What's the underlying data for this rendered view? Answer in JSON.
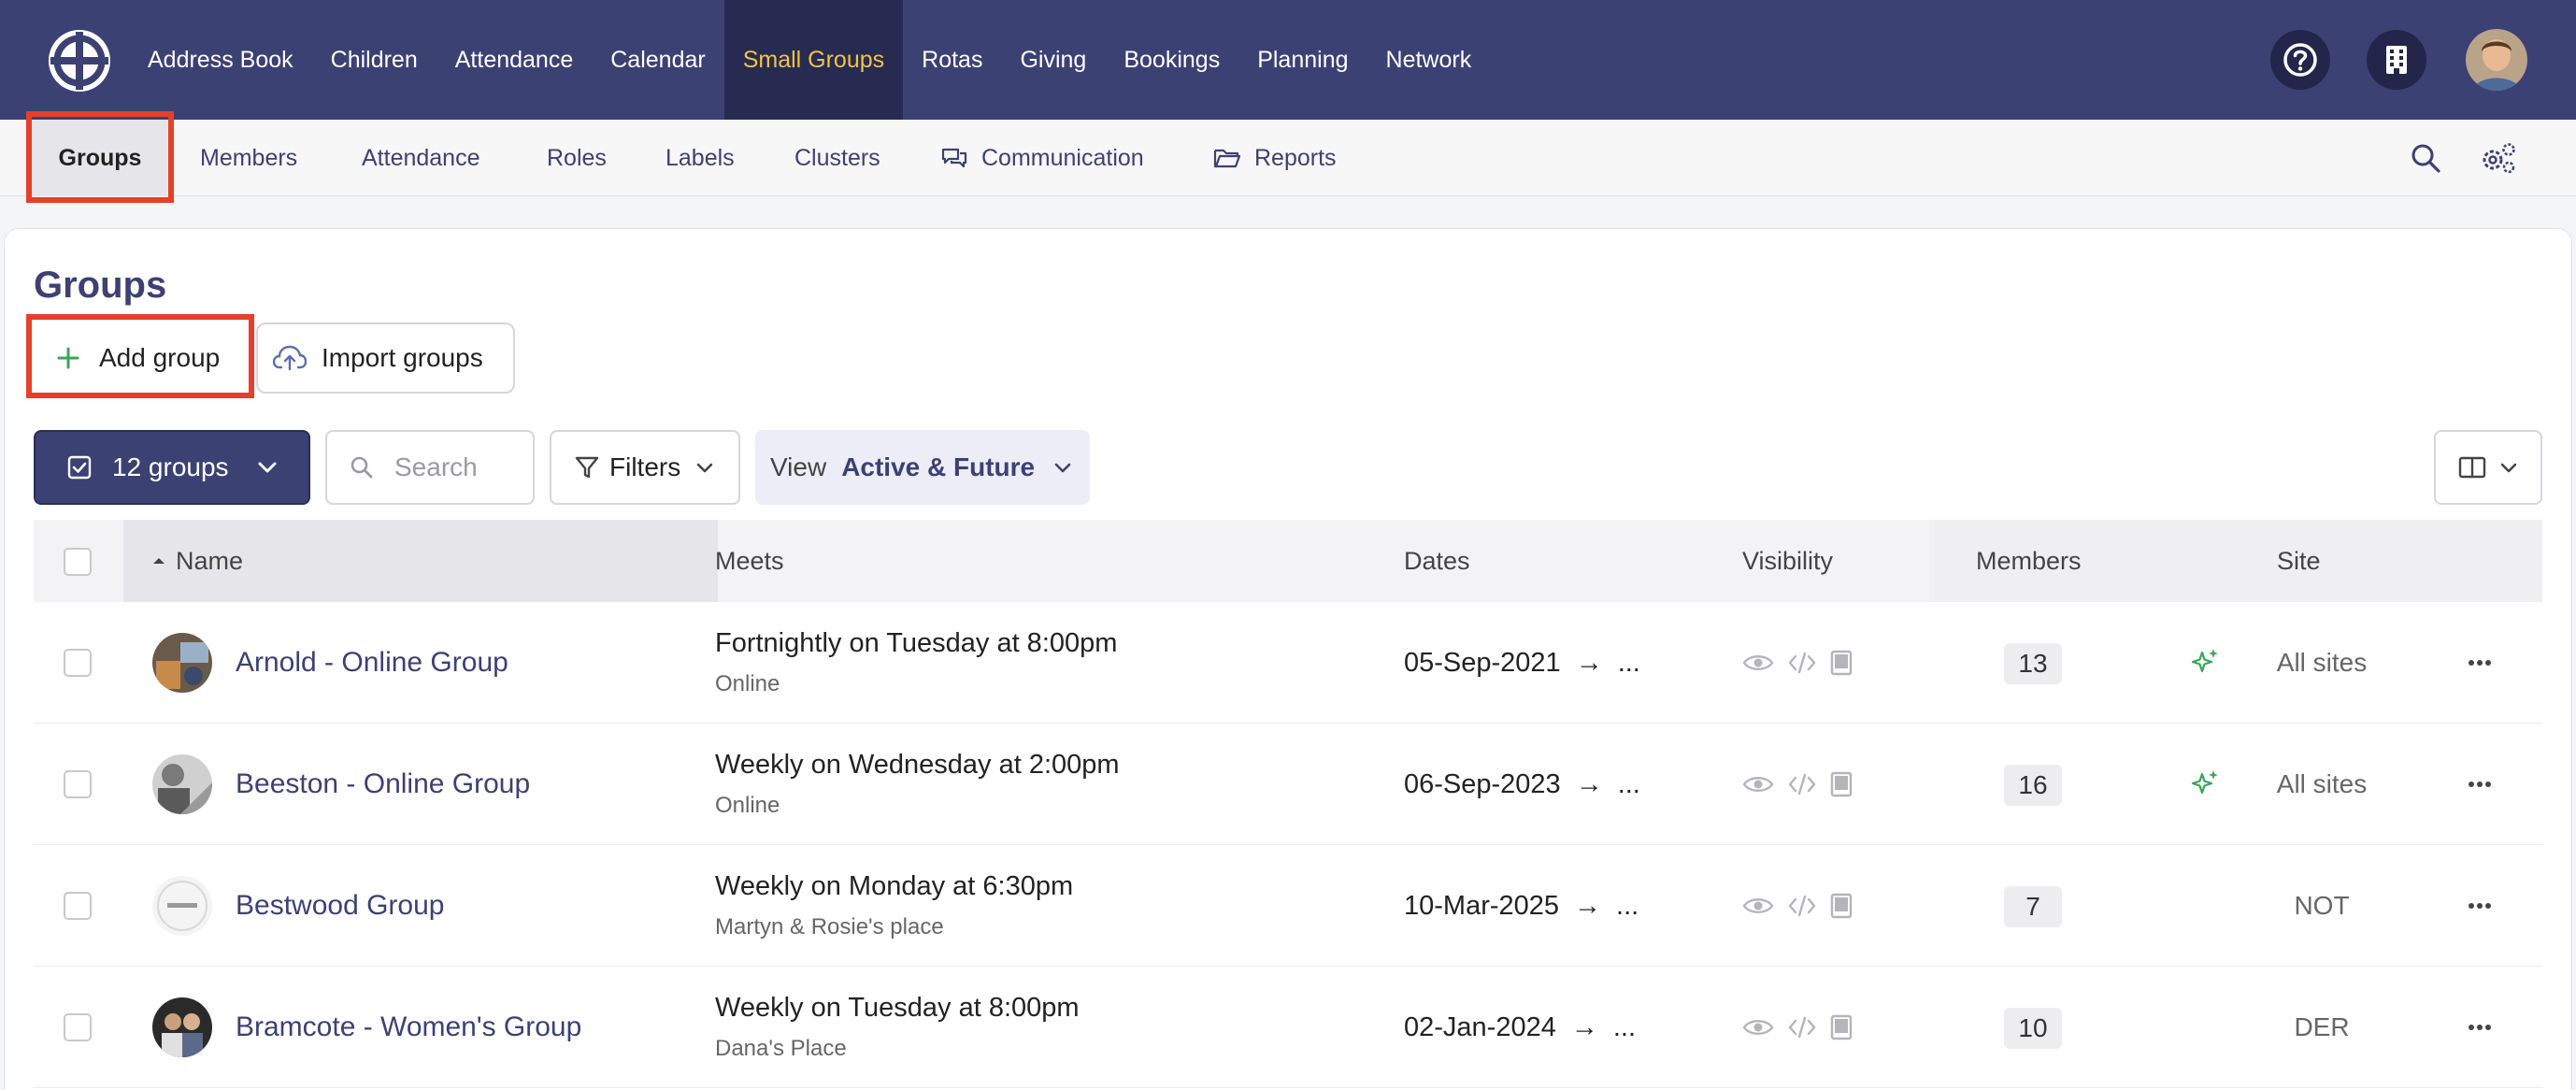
{
  "topnav": {
    "items": [
      {
        "label": "Address Book"
      },
      {
        "label": "Children"
      },
      {
        "label": "Attendance"
      },
      {
        "label": "Calendar"
      },
      {
        "label": "Small Groups",
        "active": true
      },
      {
        "label": "Rotas"
      },
      {
        "label": "Giving"
      },
      {
        "label": "Bookings"
      },
      {
        "label": "Planning"
      },
      {
        "label": "Network"
      }
    ],
    "icons": [
      "help-icon",
      "building-icon",
      "user-avatar"
    ]
  },
  "subnav": {
    "items": [
      {
        "label": "Groups",
        "active": true
      },
      {
        "label": "Members"
      },
      {
        "label": "Attendance"
      },
      {
        "label": "Roles"
      },
      {
        "label": "Labels"
      },
      {
        "label": "Clusters"
      },
      {
        "label": "Communication",
        "icon": "chat-icon"
      },
      {
        "label": "Reports",
        "icon": "folder-icon"
      }
    ],
    "icons": [
      "search-icon",
      "settings-icon"
    ]
  },
  "page": {
    "title": "Groups",
    "add_label": "Add group",
    "import_label": "Import groups"
  },
  "toolbar": {
    "selection_label": "12 groups",
    "search_placeholder": "Search",
    "filters_label": "Filters",
    "view_prefix": "View",
    "view_value": "Active & Future"
  },
  "table": {
    "columns": {
      "name": "Name",
      "meets": "Meets",
      "dates": "Dates",
      "visibility": "Visibility",
      "members": "Members",
      "site": "Site"
    },
    "rows": [
      {
        "name": "Arnold - Online Group",
        "meets": "Fortnightly on Tuesday at 8:00pm",
        "location": "Online",
        "date_start": "05-Sep-2021",
        "date_end": "...",
        "members": "13",
        "site": "All sites",
        "ai": true
      },
      {
        "name": "Beeston - Online Group",
        "meets": "Weekly on Wednesday at 2:00pm",
        "location": "Online",
        "date_start": "06-Sep-2023",
        "date_end": "...",
        "members": "16",
        "site": "All sites",
        "ai": true
      },
      {
        "name": "Bestwood Group",
        "meets": "Weekly on Monday at 6:30pm",
        "location": "Martyn & Rosie's place",
        "date_start": "10-Mar-2025",
        "date_end": "...",
        "members": "7",
        "site": "NOT",
        "ai": false
      },
      {
        "name": "Bramcote - Women's Group",
        "meets": "Weekly on Tuesday at 8:00pm",
        "location": "Dana's Place",
        "date_start": "02-Jan-2024",
        "date_end": "...",
        "members": "10",
        "site": "DER",
        "ai": false
      }
    ]
  },
  "colors": {
    "brand_navy": "#3c4174",
    "active_tab_text": "#f5c242",
    "highlight": "#e5402a",
    "ai_green": "#3aa55a"
  }
}
